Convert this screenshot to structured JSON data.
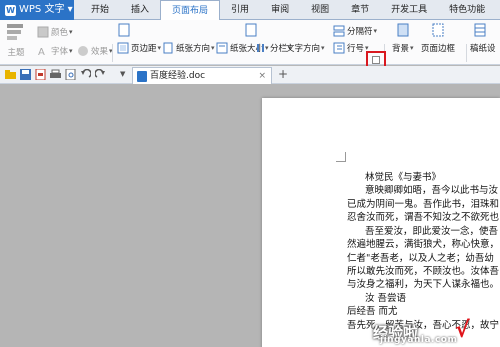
{
  "app": {
    "name": "WPS 文字",
    "logo_letter": "W"
  },
  "menu_tabs": [
    "开始",
    "插入",
    "页面布局",
    "引用",
    "审阅",
    "视图",
    "章节",
    "开发工具",
    "特色功能"
  ],
  "active_tab_index": 2,
  "ribbon": {
    "theme": "主题",
    "colors": "颜色",
    "fonts": "字体",
    "effects": "效果",
    "margins": "页边距",
    "orientation": "纸张方向",
    "size": "纸张大小",
    "columns": "分栏",
    "text_direction": "文字方向",
    "breaks": "分隔符",
    "line_numbers": "行号",
    "background": "背景",
    "page_border": "页面边框",
    "draft_paper": "稿纸设"
  },
  "document_tab": {
    "filename": "百度经验.doc",
    "close": "×",
    "add": "+"
  },
  "document": {
    "lines": [
      "林觉民《与妻书》",
      "意映卿卿如晤，吾今以此书与汝",
      "已成为阴间一鬼。吾作此书，泪珠和",
      "忍舍汝而死，谓吾不知汝之不欲死也",
      "吾至爱汝，即此爱汝一念，使吾",
      "然遍地腥云，满街狼犬，称心快意，",
      "仁者\"老吾老，以及人之老；幼吾幼",
      "所以敢先汝而死，不顾汝也。汝体吾",
      "与汝身之福利，为天下人谋永福也。",
      "汝                        吾尝语",
      "后经吾                        而尤",
      "吾先死，留苦与汝，吾心不忍，故宁"
    ]
  },
  "watermark": {
    "text": "经验啦",
    "url": "jingyanla.com",
    "check": "√"
  },
  "colors": {
    "accent": "#2b73c7",
    "highlight": "#d9181f"
  }
}
